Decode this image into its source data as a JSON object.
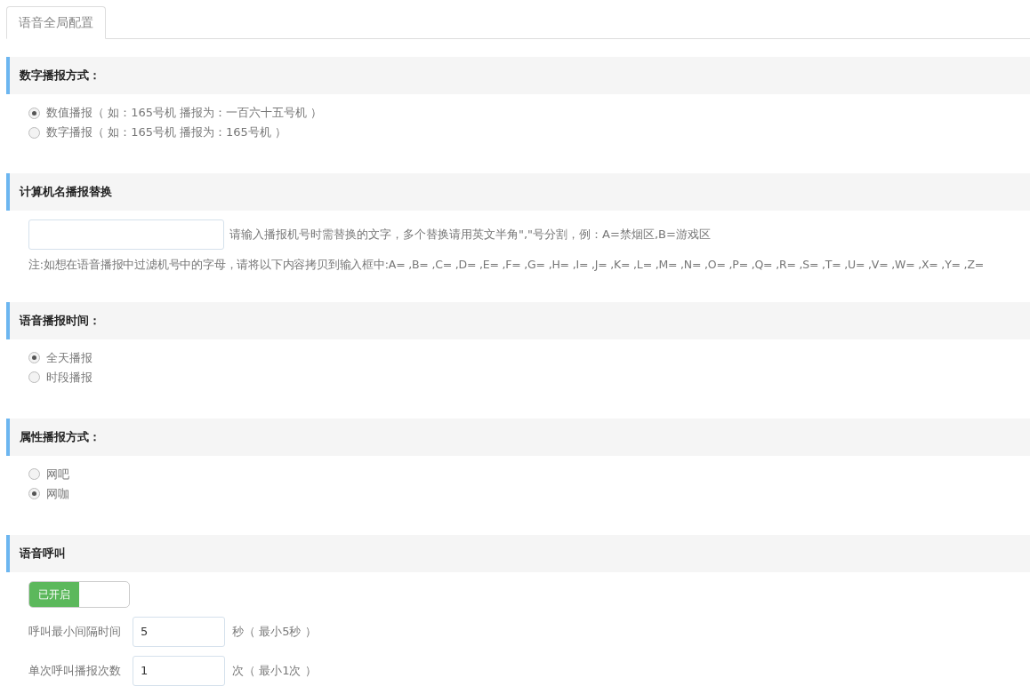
{
  "tabs": [
    {
      "label": "语音全局配置",
      "selected": true
    }
  ],
  "sections": [
    {
      "kind": "radio",
      "title": "数字播报方式：",
      "options": [
        {
          "label": "数值播报（ 如：165号机 播报为：一百六十五号机 ）",
          "selected": true
        },
        {
          "label": "数字播报（ 如：165号机 播报为：165号机 ）",
          "selected": false
        }
      ]
    },
    {
      "kind": "replace",
      "title": "计算机名播报替换",
      "hint": "请输入播报机号时需替换的文字，多个替换请用英文半角\",\"号分割，例：A=禁烟区,B=游戏区",
      "note": "注:如想在语音播报中过滤机号中的字母，请将以下内容拷贝到输入框中:A= ,B= ,C= ,D= ,E= ,F= ,G= ,H= ,I= ,J= ,K= ,L= ,M= ,N= ,O= ,P= ,Q= ,R= ,S= ,T= ,U= ,V= ,W= ,X= ,Y= ,Z="
    },
    {
      "kind": "radio",
      "title": "语音播报时间：",
      "options": [
        {
          "label": "全天播报",
          "selected": true
        },
        {
          "label": "时段播报",
          "selected": false
        }
      ]
    },
    {
      "kind": "radio",
      "title": "属性播报方式：",
      "options": [
        {
          "label": "网吧",
          "selected": false
        },
        {
          "label": "网咖",
          "selected": true
        }
      ]
    },
    {
      "kind": "call",
      "title": "语音呼叫",
      "switch": {
        "label": "已开启",
        "on": true
      },
      "fields": [
        {
          "label": "呼叫最小间隔时间",
          "value": "5",
          "suffix": "秒（ 最小5秒 ）"
        },
        {
          "label": "单次呼叫播报次数",
          "value": "1",
          "suffix": "次（ 最小1次 ）"
        }
      ]
    }
  ]
}
